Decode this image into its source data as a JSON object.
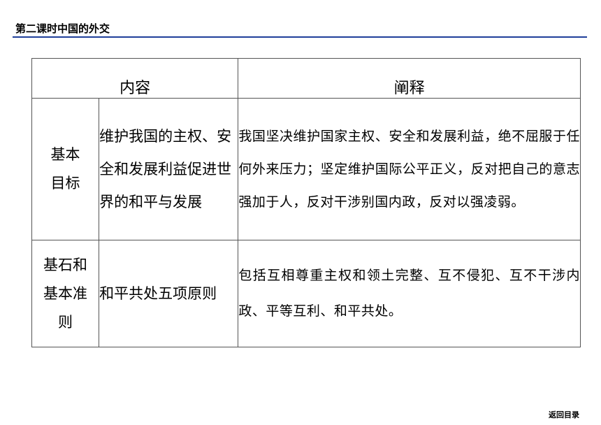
{
  "header": {
    "title": "第二课时中国的外交"
  },
  "table": {
    "col_content": "内容",
    "col_explain": "阐释",
    "rows": [
      {
        "category_line1": "基本",
        "category_line2": "目标",
        "category_line3": "",
        "content": "维护我国的主权、安全和发展利益促进世界的和平与发展",
        "explain": "我国坚决维护国家主权、安全和发展利益，绝不屈服于任何外来压力；坚定维护国际公平正义，反对把自己的意志强加于人，反对干涉别国内政，反对以强凌弱。"
      },
      {
        "category_line1": "基石和",
        "category_line2": "基本准",
        "category_line3": "则",
        "content": "和平共处五项原则",
        "explain": "包括互相尊重主权和领土完整、互不侵犯、互不干涉内政、平等互利、和平共处。"
      }
    ]
  },
  "footer": {
    "back_link": "返回目录"
  },
  "colors": {
    "header_rule": "#1f3f9a",
    "table_border": "#555555"
  }
}
